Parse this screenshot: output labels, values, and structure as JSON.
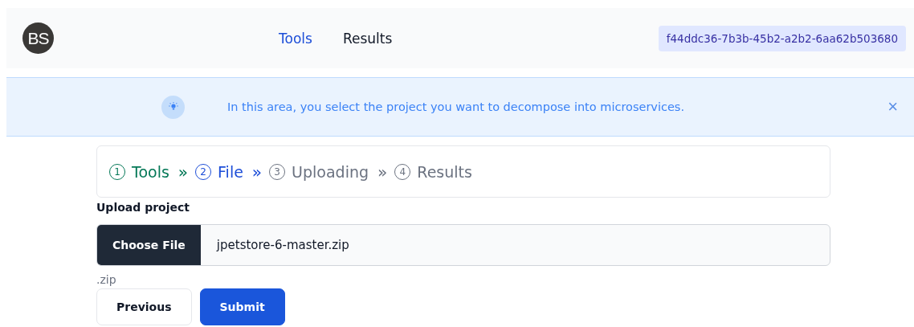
{
  "logo": {
    "text": "BS"
  },
  "nav": [
    {
      "label": "Tools",
      "selected": true
    },
    {
      "label": "Results",
      "selected": false
    }
  ],
  "session_id": "f44ddc36-7b3b-45b2-a2b2-6aa62b503680",
  "alert": {
    "message": "In this area, you select the project you want to decompose into microservices.",
    "close": "×"
  },
  "steps": [
    {
      "number": "1",
      "label": "Tools",
      "done": true,
      "selected": false
    },
    {
      "number": "2",
      "label": "File",
      "done": false,
      "selected": true
    },
    {
      "number": "3",
      "label": "Uploading",
      "done": false,
      "selected": false
    },
    {
      "number": "4",
      "label": "Results",
      "done": false,
      "selected": false
    }
  ],
  "step_separator": "»",
  "upload": {
    "label": "Upload project",
    "button": "Choose File",
    "value": "jpetstore-6-master.zip",
    "hint": ".zip"
  },
  "buttons": [
    {
      "label": "Previous",
      "kind": "secondary"
    },
    {
      "label": "Submit",
      "kind": "primary"
    }
  ]
}
